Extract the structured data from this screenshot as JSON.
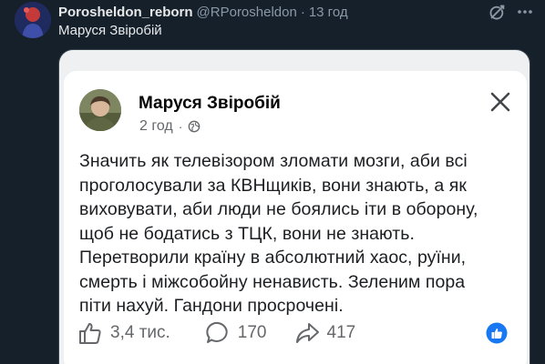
{
  "tweet": {
    "author_name": "Porosheldon_reborn",
    "author_handle": "@RPorosheldon",
    "separator": "·",
    "time": "13 год",
    "text": "Маруся Звіробій"
  },
  "fb_post": {
    "author_name": "Маруся Звіробій",
    "time": "2 год",
    "separator": "·",
    "body_lines": [
      "Значить як телевізором зломати мозги, аби всі",
      "проголосували за КВНщиків, вони знають, а як",
      "виховувати, аби люди не боялись іти в оборону,",
      "щоб не бодатись з ТЦК, вони не знають.",
      "Перетворили країну в абсолютний хаос, руїни,",
      "смерть і міжсобойну ненависть. Зеленим пора",
      "піти нахуй. Гандони просрочені."
    ],
    "likes": "3,4 тис.",
    "comments": "170",
    "shares": "417"
  },
  "colors": {
    "background": "#15202b",
    "text_primary": "#e7e9ea",
    "text_secondary": "#8b98a5",
    "fb_text": "#1c1e21",
    "fb_meta": "#65676b",
    "fb_blue": "#1877f2"
  }
}
